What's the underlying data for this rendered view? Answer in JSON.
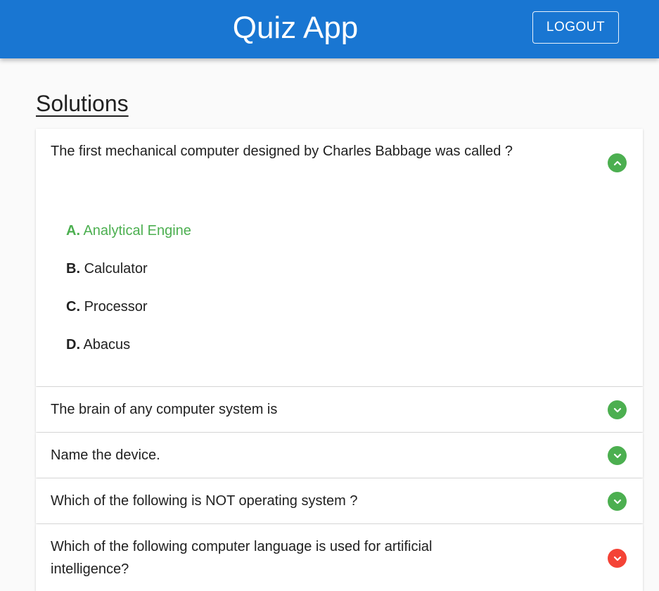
{
  "header": {
    "title": "Quiz App",
    "logout_label": "LOGOUT"
  },
  "page": {
    "heading": "Solutions"
  },
  "questions": [
    {
      "text": "The first mechanical computer designed by Charles Babbage was called ?",
      "expanded": true,
      "status": "correct",
      "options": [
        {
          "letter": "A.",
          "text": "Analytical Engine",
          "correct": true
        },
        {
          "letter": "B.",
          "text": "Calculator",
          "correct": false
        },
        {
          "letter": "C.",
          "text": "Processor",
          "correct": false
        },
        {
          "letter": "D.",
          "text": "Abacus",
          "correct": false
        }
      ]
    },
    {
      "text": "The brain of any computer system is",
      "expanded": false,
      "status": "correct"
    },
    {
      "text": "Name the device.",
      "expanded": false,
      "status": "correct"
    },
    {
      "text": "Which of the following is NOT operating system ?",
      "expanded": false,
      "status": "correct"
    },
    {
      "text": "Which of the following computer language is used for artificial intelligence?",
      "expanded": false,
      "status": "incorrect"
    }
  ],
  "icons": {
    "expanded": "chevron-up-icon",
    "collapsed": "chevron-down-icon"
  },
  "colors": {
    "appbar": "#1976d2",
    "correct": "#4caf50",
    "incorrect": "#f44336"
  }
}
